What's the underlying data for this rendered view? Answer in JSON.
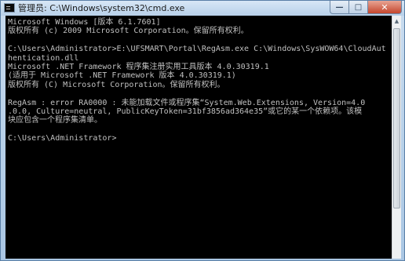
{
  "window": {
    "title": "管理员: C:\\Windows\\system32\\cmd.exe",
    "controls": {
      "minimize": "—",
      "maximize": "□",
      "close": "✕"
    }
  },
  "console": {
    "lines": [
      "Microsoft Windows [版本 6.1.7601]",
      "版权所有 (c) 2009 Microsoft Corporation。保留所有权利。",
      "",
      "C:\\Users\\Administrator>E:\\UFSMART\\Portal\\RegAsm.exe C:\\Windows\\SysWOW64\\CloudAut",
      "hentication.dll",
      "Microsoft .NET Framework 程序集注册实用工具版本 4.0.30319.1",
      "(适用于 Microsoft .NET Framework 版本 4.0.30319.1)",
      "版权所有 (C) Microsoft Corporation。保留所有权利。",
      "",
      "RegAsm : error RA0000 : 未能加载文件或程序集“System.Web.Extensions, Version=4.0",
      ".0.0, Culture=neutral, PublicKeyToken=31bf3856ad364e35”或它的某一个依赖项。该模",
      "块应包含一个程序集清单。",
      "",
      "C:\\Users\\Administrator>"
    ]
  },
  "scrollbar": {
    "up_arrow": "▲"
  },
  "colors": {
    "console_bg": "#000000",
    "console_fg": "#c0c0c0",
    "close_button": "#c4462d"
  }
}
